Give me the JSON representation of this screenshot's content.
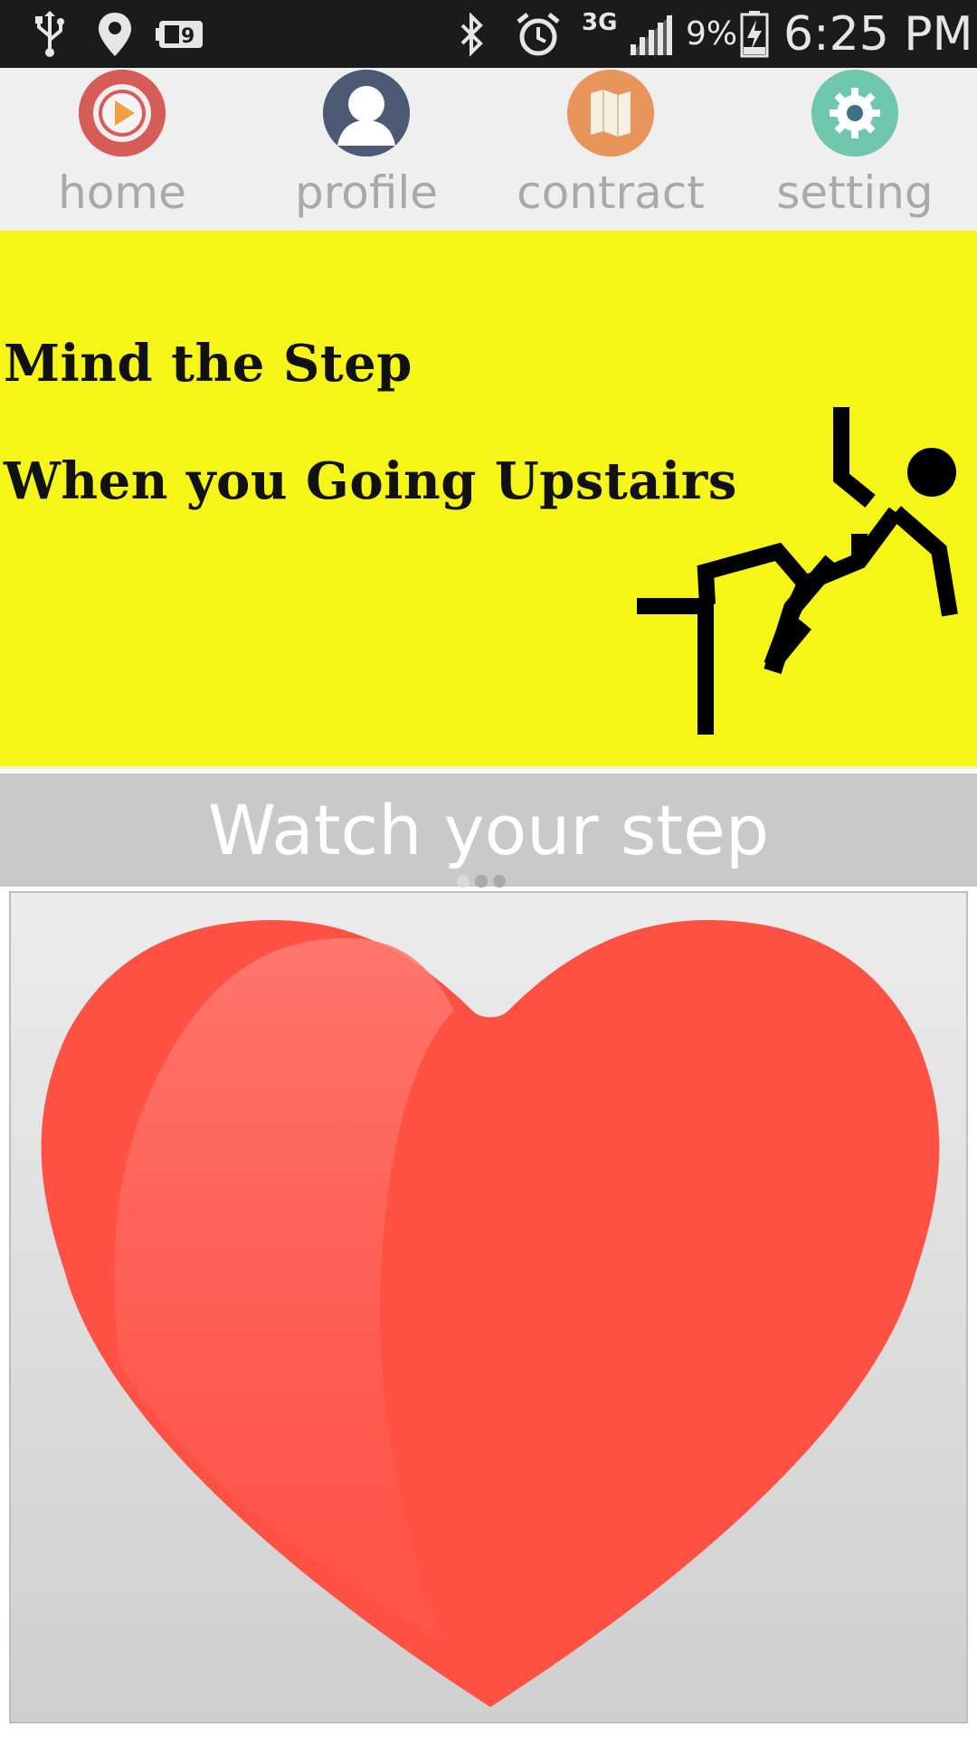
{
  "status_bar": {
    "icons": [
      "usb-icon",
      "location-pin-icon",
      "battery-saver-icon",
      "bluetooth-icon",
      "alarm-icon",
      "network-3g-icon",
      "signal-icon",
      "battery-charging-icon"
    ],
    "network_type": "3G",
    "battery_percent": "9%",
    "time": "6:25 PM"
  },
  "nav": {
    "items": [
      {
        "label": "home",
        "icon": "play-icon",
        "color": "#d9534f"
      },
      {
        "label": "profile",
        "icon": "person-icon",
        "color": "#4c5a75"
      },
      {
        "label": "contract",
        "icon": "map-icon",
        "color": "#e8955b"
      },
      {
        "label": "setting",
        "icon": "gear-icon",
        "color": "#6fc7ae"
      }
    ]
  },
  "banner": {
    "line1": "Mind the Step",
    "line2": "When you Going Upstairs",
    "background": "#f5f518",
    "figure_icon": "falling-person-icon"
  },
  "caption": {
    "text": "Watch your step"
  },
  "pager": {
    "count": 3,
    "active_index": 0
  },
  "card": {
    "icon": "heart-icon",
    "heart_color": "#ff5245"
  }
}
